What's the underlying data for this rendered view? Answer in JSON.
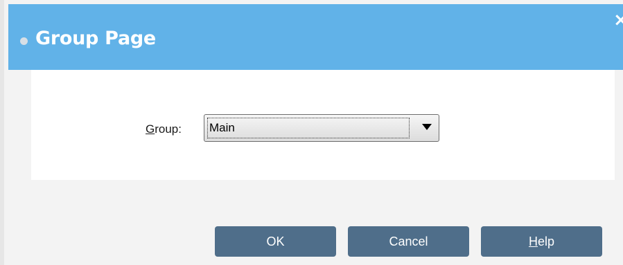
{
  "dialog": {
    "title": "Group Page",
    "close_symbol": "×"
  },
  "form": {
    "group_label_accel": "G",
    "group_label_rest": "roup:",
    "group_selected": "Main"
  },
  "buttons": {
    "ok": "OK",
    "cancel": "Cancel",
    "help_accel": "H",
    "help_rest": "elp"
  },
  "icons": {
    "title_dot": "bullet-icon",
    "close": "close-icon",
    "dropdown": "chevron-down-icon"
  },
  "colors": {
    "title_bar": "#61b2e8",
    "button": "#4f6e8a"
  }
}
